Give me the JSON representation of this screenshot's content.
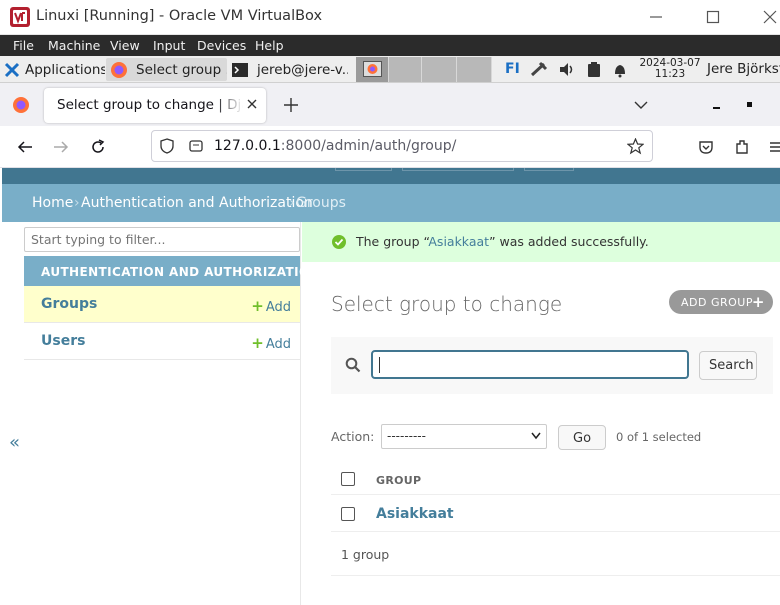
{
  "vbox": {
    "title": "Linuxi [Running] - Oracle VM VirtualBox",
    "menu": [
      "File",
      "Machine",
      "View",
      "Input",
      "Devices",
      "Help"
    ]
  },
  "panel": {
    "applications": "Applications",
    "taskbar": [
      "Select group ...",
      "jereb@jere-v..."
    ],
    "keyboard_layout": "FI",
    "date": "2024-03-07",
    "time": "11:23",
    "user": "Jere Björkst"
  },
  "firefox": {
    "tab_title": "Select group to change | Django site admin",
    "url_host": "127.0.0.1",
    "url_rest": ":8000/admin/auth/group/"
  },
  "admin": {
    "breadcrumbs": {
      "home": "Home",
      "sep": "›",
      "app": "Authentication and Authorization",
      "current": "Groups"
    },
    "nav_filter_placeholder": "Start typing to filter...",
    "app_caption": "AUTHENTICATION AND AUTHORIZATION",
    "models": [
      {
        "name": "Groups",
        "add": "Add"
      },
      {
        "name": "Users",
        "add": "Add"
      }
    ],
    "collapse": "«",
    "message": {
      "before": "The group “",
      "link": "Asiakkaat",
      "after": "” was added successfully."
    },
    "title": "Select group to change",
    "add_button": "ADD GROUP",
    "search_button": "Search",
    "action_label": "Action:",
    "action_value": "---------",
    "go": "Go",
    "selected_counter": "0 of 1 selected",
    "column_header": "GROUP",
    "rows": [
      "Asiakkaat"
    ],
    "paginator": "1 group"
  },
  "colors": {
    "header": "#417690",
    "breadcrumbs": "#79aec8",
    "link": "#447e9b",
    "success_bg": "#ddffdd",
    "current_model_bg": "#ffffcc"
  }
}
